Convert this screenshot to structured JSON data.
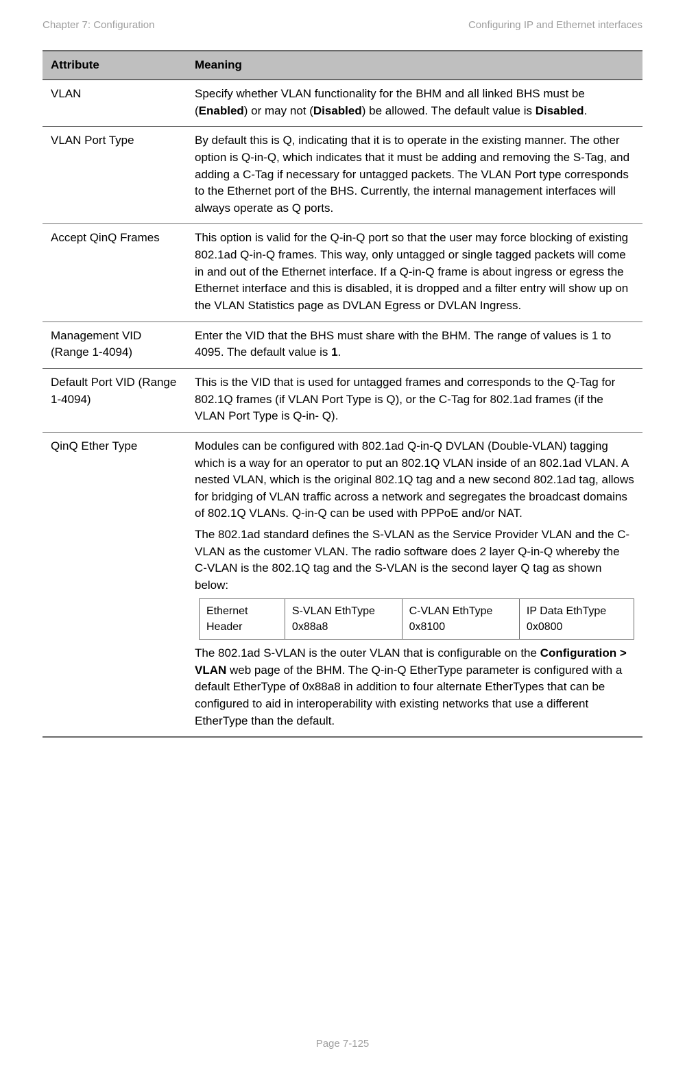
{
  "header": {
    "left": "Chapter 7:  Configuration",
    "right": "Configuring IP and Ethernet interfaces"
  },
  "table": {
    "head": {
      "attr": "Attribute",
      "meaning": "Meaning"
    },
    "rows": [
      {
        "attr": "VLAN",
        "p1a": "Specify whether VLAN functionality for the BHM and all linked BHS must be (",
        "p1b": "Enabled",
        "p1c": ") or may not (",
        "p1d": "Disabled",
        "p1e": ") be allowed. The default value is ",
        "p1f": "Disabled",
        "p1g": "."
      },
      {
        "attr": "VLAN Port Type",
        "p1": "By default this is Q, indicating that it is to operate in the existing manner. The other option is Q-in-Q, which indicates that it must be adding and removing the S-Tag, and adding a C-Tag if necessary for untagged packets. The VLAN Port type corresponds to the Ethernet port of the BHS. Currently, the internal management interfaces will always operate as Q ports."
      },
      {
        "attr": "Accept QinQ Frames",
        "p1": "This option is valid for the Q-in-Q port so that the user may force blocking of existing 802.1ad Q-in-Q frames. This way, only untagged or single tagged packets will come in and out of the Ethernet interface. If a Q-in-Q frame is about ingress or egress the Ethernet interface and this is disabled, it is dropped and a filter entry will show up on the VLAN Statistics page as DVLAN Egress or DVLAN Ingress."
      },
      {
        "attr": "Management VID (Range 1-4094)",
        "p1a": "Enter the VID that the BHS must share with the BHM. The range of values is 1 to 4095. The default value is ",
        "p1b": "1",
        "p1c": "."
      },
      {
        "attr": "Default Port VID (Range 1-4094)",
        "p1": "This is the VID that is used for untagged frames and corresponds to the Q-Tag for 802.1Q frames (if VLAN Port Type is Q), or the C-Tag for 802.1ad frames (if the VLAN Port Type is Q-in- Q)."
      },
      {
        "attr": "QinQ Ether Type",
        "p1": "Modules can be configured with 802.1ad Q-in-Q DVLAN (Double-VLAN) tagging which is a way for an operator to put an 802.1Q VLAN inside of an 802.1ad VLAN. A nested VLAN, which is the original 802.1Q tag and a new second 802.1ad tag, allows for bridging of VLAN traffic across a network and segregates the broadcast domains of 802.1Q VLANs. Q-in-Q can be used with PPPoE and/or NAT.",
        "p2": "The 802.1ad standard defines the S-VLAN as the Service Provider VLAN and the C-VLAN as the customer VLAN. The radio software does 2 layer Q-in-Q whereby the C-VLAN is the 802.1Q tag and the S-VLAN is the second layer Q tag as shown below:",
        "inner": {
          "c1": "Ethernet Header",
          "c2": "S-VLAN EthType 0x88a8",
          "c3": "C-VLAN EthType 0x8100",
          "c4": "IP Data EthType 0x0800"
        },
        "p3a": "The 802.1ad S-VLAN is the outer VLAN that is configurable on the ",
        "p3b": "Configuration > VLAN",
        "p3c": " web page of the BHM. The Q-in-Q EtherType parameter is configured with a default EtherType of 0x88a8 in addition to four alternate EtherTypes that can be configured to aid in interoperability with existing networks that use a different EtherType than the default."
      }
    ]
  },
  "footer": "Page 7-125"
}
